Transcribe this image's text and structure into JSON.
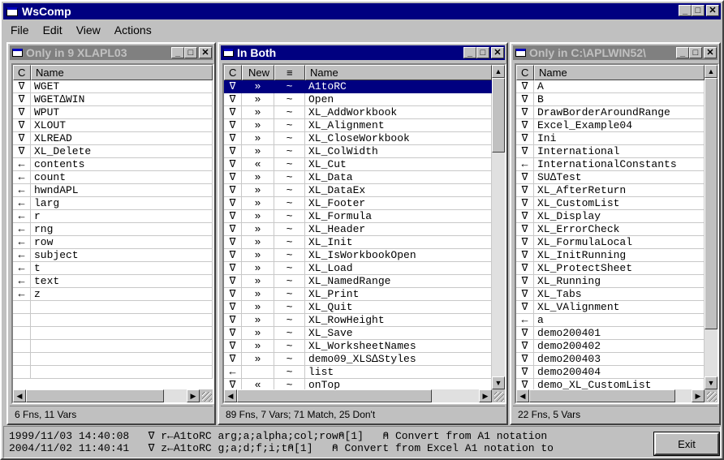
{
  "app": {
    "title": "WsComp"
  },
  "menu": [
    "File",
    "Edit",
    "View",
    "Actions"
  ],
  "left": {
    "title": "Only in 9 XLAPL03",
    "headers": [
      "C",
      "Name"
    ],
    "rows": [
      [
        "∇",
        "WGET"
      ],
      [
        "∇",
        "WGET∆WIN"
      ],
      [
        "∇",
        "WPUT"
      ],
      [
        "∇",
        "XLOUT"
      ],
      [
        "∇",
        "XLREAD"
      ],
      [
        "∇",
        "XL_Delete"
      ],
      [
        "←",
        "contents"
      ],
      [
        "←",
        "count"
      ],
      [
        "←",
        "hwndAPL"
      ],
      [
        "←",
        "larg"
      ],
      [
        "←",
        "r"
      ],
      [
        "←",
        "rng"
      ],
      [
        "←",
        "row"
      ],
      [
        "←",
        "subject"
      ],
      [
        "←",
        "t"
      ],
      [
        "←",
        "text"
      ],
      [
        "←",
        "z"
      ]
    ],
    "status": "6 Fns, 11 Vars"
  },
  "middle": {
    "title": "In Both",
    "headers": [
      "C",
      "New",
      "≡",
      "Name"
    ],
    "rows": [
      [
        "∇",
        "»",
        "~",
        "A1toRC"
      ],
      [
        "∇",
        "»",
        "~",
        "Open"
      ],
      [
        "∇",
        "»",
        "~",
        "XL_AddWorkbook"
      ],
      [
        "∇",
        "»",
        "~",
        "XL_Alignment"
      ],
      [
        "∇",
        "»",
        "~",
        "XL_CloseWorkbook"
      ],
      [
        "∇",
        "»",
        "~",
        "XL_ColWidth"
      ],
      [
        "∇",
        "«",
        "~",
        "XL_Cut"
      ],
      [
        "∇",
        "»",
        "~",
        "XL_Data"
      ],
      [
        "∇",
        "»",
        "~",
        "XL_DataEx"
      ],
      [
        "∇",
        "»",
        "~",
        "XL_Footer"
      ],
      [
        "∇",
        "»",
        "~",
        "XL_Formula"
      ],
      [
        "∇",
        "»",
        "~",
        "XL_Header"
      ],
      [
        "∇",
        "»",
        "~",
        "XL_Init"
      ],
      [
        "∇",
        "»",
        "~",
        "XL_IsWorkbookOpen"
      ],
      [
        "∇",
        "»",
        "~",
        "XL_Load"
      ],
      [
        "∇",
        "»",
        "~",
        "XL_NamedRange"
      ],
      [
        "∇",
        "»",
        "~",
        "XL_Print"
      ],
      [
        "∇",
        "»",
        "~",
        "XL_Quit"
      ],
      [
        "∇",
        "»",
        "~",
        "XL_RowHeight"
      ],
      [
        "∇",
        "»",
        "~",
        "XL_Save"
      ],
      [
        "∇",
        "»",
        "~",
        "XL_WorksheetNames"
      ],
      [
        "∇",
        "»",
        "~",
        "demo09_XLS∆Styles"
      ],
      [
        "←",
        "",
        "~",
        "list"
      ],
      [
        "∇",
        "«",
        "~",
        "onTop"
      ]
    ],
    "status": "89 Fns, 7 Vars; 71 Match, 25 Don't"
  },
  "right": {
    "title": "Only in C:\\APLWIN52\\",
    "headers": [
      "C",
      "Name"
    ],
    "rows": [
      [
        "∇",
        "A"
      ],
      [
        "∇",
        "B"
      ],
      [
        "∇",
        "DrawBorderAroundRange"
      ],
      [
        "∇",
        "Excel_Example04"
      ],
      [
        "∇",
        "Ini"
      ],
      [
        "∇",
        "International"
      ],
      [
        "←",
        "InternationalConstants"
      ],
      [
        "∇",
        "SU∆Test"
      ],
      [
        "∇",
        "XL_AfterReturn"
      ],
      [
        "∇",
        "XL_CustomList"
      ],
      [
        "∇",
        "XL_Display"
      ],
      [
        "∇",
        "XL_ErrorCheck"
      ],
      [
        "∇",
        "XL_FormulaLocal"
      ],
      [
        "∇",
        "XL_InitRunning"
      ],
      [
        "∇",
        "XL_ProtectSheet"
      ],
      [
        "∇",
        "XL_Running"
      ],
      [
        "∇",
        "XL_Tabs"
      ],
      [
        "∇",
        "XL_VAlignment"
      ],
      [
        "←",
        "a"
      ],
      [
        "∇",
        "demo200401"
      ],
      [
        "∇",
        "demo200402"
      ],
      [
        "∇",
        "demo200403"
      ],
      [
        "∇",
        "demo200404"
      ],
      [
        "∇",
        "demo_XL_CustomList"
      ]
    ],
    "status": "22 Fns, 5 Vars"
  },
  "bottom": {
    "line1": "1999/11/03 14:40:08   ∇ r←A1toRC arg;a;alpha;col;row⍝[1]   ⍝ Convert from A1 notation",
    "line2": "2004/11/02 11:40:41   ∇ z←A1toRC g;a;d;f;i;t⍝[1]   ⍝ Convert from Excel A1 notation to",
    "exit_label": "Exit"
  }
}
